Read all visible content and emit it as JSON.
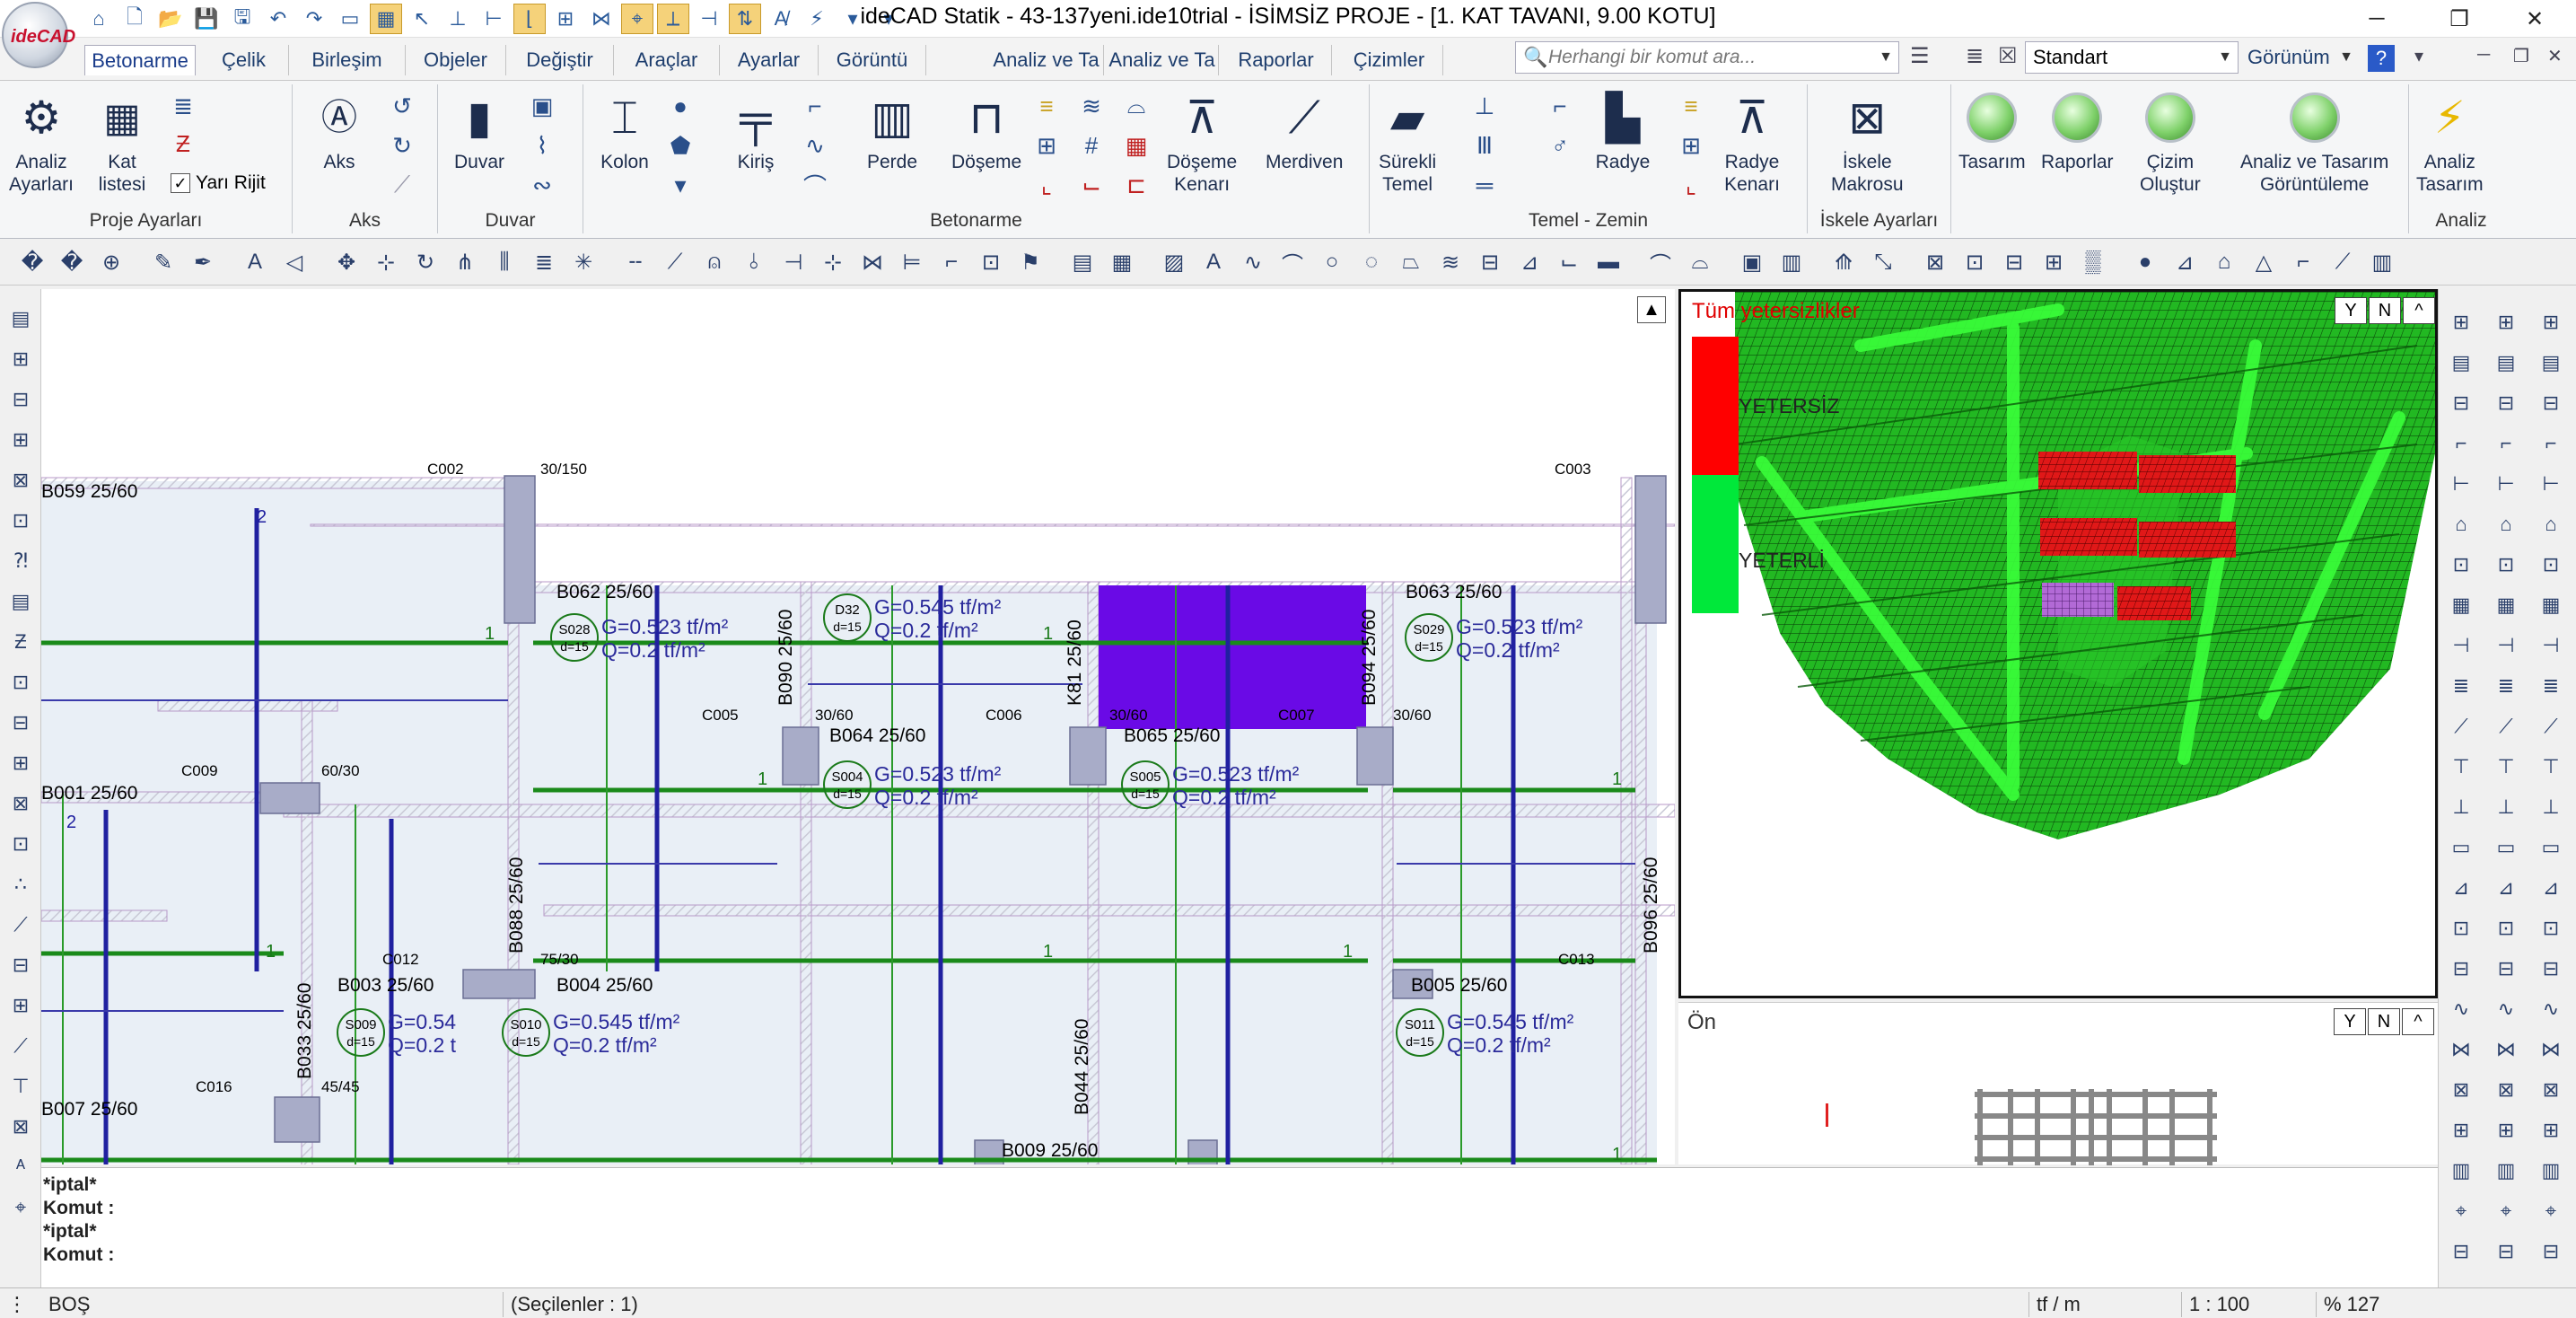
{
  "app": {
    "logo_text": "ideCAD",
    "title": "ideCAD Statik - 43-137yeni.ide10trial - İSİMSİZ PROJE - [1. KAT TAVANI,  9.00 KOTU]"
  },
  "quick_access": [
    "home-icon",
    "new-file-icon",
    "open-folder-icon",
    "save-icon",
    "save-all-icon",
    "undo-icon",
    "redo-icon",
    "monitor-icon",
    "grid-toggle-icon",
    "pointer-icon",
    "snap-icon",
    "ortho-icon",
    "snap-end-icon",
    "grid-snap-icon",
    "snap-mid-icon",
    "snap-node-icon",
    "snap-line-icon",
    "snap-perp-icon",
    "snap-dir-icon",
    "text-snap-icon",
    "lightning-icon",
    "dropdown-icon",
    "customize-icon"
  ],
  "tabs": [
    "Betonarme",
    "Çelik",
    "Birleşim",
    "Objeler",
    "Değiştir",
    "Araçlar",
    "Ayarlar",
    "Görüntü",
    "Analiz ve Ta",
    "Analiz ve Ta",
    "Raporlar",
    "Çizimler"
  ],
  "active_tab": "Betonarme",
  "search": {
    "placeholder": "Herhangi bir komut ara..."
  },
  "style_select": {
    "value": "Standart"
  },
  "view_menu": {
    "label": "Görünüm"
  },
  "ribbon": {
    "proje": {
      "label": "Proje Ayarları",
      "analiz": "Analiz\nAyarları",
      "kat": "Kat\nlistesi",
      "yari_rijit": "Yarı Rijit"
    },
    "aks": {
      "label": "Aks",
      "btn": "Aks"
    },
    "duvar": {
      "label": "Duvar",
      "btn": "Duvar"
    },
    "betonarme": {
      "label": "Betonarme",
      "kolon": "Kolon",
      "kiris": "Kiriş",
      "perde": "Perde",
      "doseme": "Döşeme",
      "doseme_kenari": "Döşeme\nKenarı",
      "merdiven": "Merdiven"
    },
    "temel": {
      "label": "Temel - Zemin",
      "surekli": "Sürekli\nTemel",
      "radye": "Radye",
      "radye_kenari": "Radye\nKenarı"
    },
    "iskele": {
      "label": "İskele Ayarları",
      "btn": "İskele\nMakrosu"
    },
    "views": {
      "tasarim": "Tasarım",
      "raporlar": "Raporlar",
      "cizim": "Çizim\nOluştur",
      "analiz_gor": "Analiz ve Tasarım\nGörüntüleme"
    },
    "analiz": {
      "label": "Analiz",
      "btn": "Analiz\nTasarım"
    }
  },
  "plan": {
    "beams": [
      "B059 25/60",
      "B062 25/60",
      "B063 25/60",
      "B064 25/60",
      "B065 25/60",
      "B001 25/60",
      "B003 25/60",
      "B004 25/60",
      "B005 25/60",
      "B009 25/60",
      "B007 25/60"
    ],
    "vbeams": [
      "B090 25/60",
      "K81 25/60",
      "B094 25/60",
      "B088 25/60",
      "B096 25/60",
      "B033 25/60",
      "B044 25/60"
    ],
    "columns": [
      "C002",
      "C003",
      "C005",
      "C006",
      "C007",
      "C009",
      "C012",
      "C013",
      "C016"
    ],
    "col_dims": [
      "30/150",
      "30/60",
      "30/60",
      "30/60",
      "60/30",
      "75/30",
      "45/45"
    ],
    "slabs": [
      {
        "id": "S028",
        "d": "d=15",
        "g": "G=0.523 tf/m²",
        "q": "Q=0.2 tf/m²"
      },
      {
        "id": "D32",
        "d": "d=15",
        "g": "G=0.545 tf/m²",
        "q": "Q=0.2 tf/m²"
      },
      {
        "id": "S029",
        "d": "d=15",
        "g": "G=0.523 tf/m²",
        "q": "Q=0.2 tf/m²"
      },
      {
        "id": "S004",
        "d": "d=15",
        "g": "G=0.523 tf/m²",
        "q": "Q=0.2 tf/m²"
      },
      {
        "id": "S005",
        "d": "d=15",
        "g": "G=0.523 tf/m²",
        "q": "Q=0.2 tf/m²"
      },
      {
        "id": "S009",
        "d": "d=15",
        "g": "G=0.54",
        "q": "Q=0.2 t"
      },
      {
        "id": "S010",
        "d": "d=15",
        "g": "G=0.545 tf/m²",
        "q": "Q=0.2 tf/m²"
      },
      {
        "id": "S011",
        "d": "d=15",
        "g": "G=0.545 tf/m²",
        "q": "Q=0.2 tf/m²"
      }
    ],
    "marks": [
      "1",
      "2"
    ]
  },
  "view3d": {
    "title": "Tüm yetersizlikler",
    "leg_bad": "YETERSİZ",
    "leg_ok": "YETERLİ",
    "color_bad": "#ff0000",
    "color_ok": "#00e83a"
  },
  "view_front": {
    "label": "Ön"
  },
  "view_ctl": [
    "Y",
    "N",
    "^"
  ],
  "console": [
    "*iptal*",
    "Komut :",
    "*iptal*",
    "Komut :"
  ],
  "status": {
    "mode": "BOŞ",
    "selected": "(Seçilenler : 1)",
    "unit": "tf / m",
    "scale": "1 : 100",
    "zoom": "% 127"
  },
  "colors": {
    "beam_line": "#2020a0",
    "green_line": "#1a8a1a",
    "selected_fill": "#6a0ae6",
    "column_fill": "#a8acc8"
  }
}
